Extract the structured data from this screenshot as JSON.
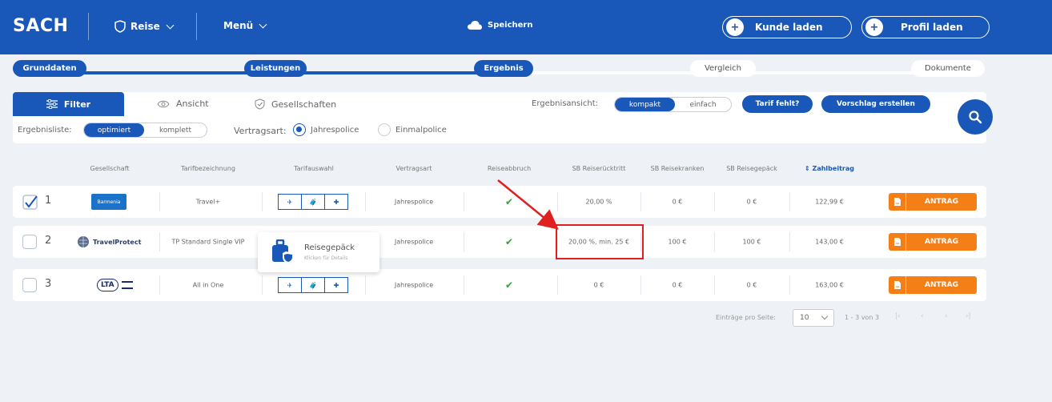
{
  "header": {
    "logo": "SACH",
    "reise_label": "Reise",
    "menu_label": "Menü",
    "save_label": "Speichern",
    "kunde_label": "Kunde laden",
    "profil_label": "Profil laden"
  },
  "steps": [
    {
      "label": "Grunddaten"
    },
    {
      "label": "Leistungen"
    },
    {
      "label": "Ergebnis"
    },
    {
      "label": "Vergleich"
    },
    {
      "label": "Dokumente"
    }
  ],
  "toolbar": {
    "filter_label": "Filter",
    "ansicht_label": "Ansicht",
    "gesellschaften_label": "Gesellschaften",
    "ergebnisansicht_label": "Ergebnisansicht:",
    "kompakt": "kompakt",
    "einfach": "einfach",
    "tarif_fehlt": "Tarif fehlt?",
    "vorschlag": "Vorschlag erstellen",
    "ergebnisliste_label": "Ergebnisliste:",
    "optimiert": "optimiert",
    "komplett": "komplett",
    "vertragsart_label": "Vertragsart:",
    "jahrespolice": "Jahrespolice",
    "einmalpolice": "Einmalpolice"
  },
  "columns": {
    "gesellschaft": "Gesellschaft",
    "tarifbezeichnung": "Tarifbezeichnung",
    "tarifauswahl": "Tarifauswahl",
    "vertragsart": "Vertragsart",
    "reiseabbruch": "Reiseabbruch",
    "sb_ruecktritt": "SB Reiserücktritt",
    "sb_kranken": "SB Reisekranken",
    "sb_gepaeck": "SB Reisegepäck",
    "zahlbeitrag": "Zahlbeitrag"
  },
  "rows": [
    {
      "num": "1",
      "company": "Barmenia",
      "tarif": "Travel+",
      "vertragsart": "Jahrespolice",
      "abbruch": "✔",
      "ruecktritt": "20,00 %",
      "kranken": "0 €",
      "gepaeck": "0 €",
      "beitrag": "122,99 €",
      "antrag": "ANTRAG",
      "checked": true
    },
    {
      "num": "2",
      "company": "TravelProtect",
      "tarif": "TP Standard Single VIP",
      "vertragsart": "Jahrespolice",
      "abbruch": "✔",
      "ruecktritt": "20,00 %, min. 25 €",
      "kranken": "100 €",
      "gepaeck": "100 €",
      "beitrag": "143,00 €",
      "antrag": "ANTRAG",
      "checked": false
    },
    {
      "num": "3",
      "company": "LTA",
      "tarif": "All in One",
      "vertragsart": "Jahrespolice",
      "abbruch": "✔",
      "ruecktritt": "0 €",
      "kranken": "0 €",
      "gepaeck": "0 €",
      "beitrag": "163,00 €",
      "antrag": "ANTRAG",
      "checked": false
    }
  ],
  "tooltip": {
    "title": "Reisegepäck",
    "subtitle": "Klicken für Details"
  },
  "pagination": {
    "label": "Einträge pro Seite:",
    "per_page": "10",
    "range": "1 - 3 von 3"
  },
  "colors": {
    "primary": "#1957b8",
    "accent": "#f57f17",
    "highlight": "#e02020"
  }
}
